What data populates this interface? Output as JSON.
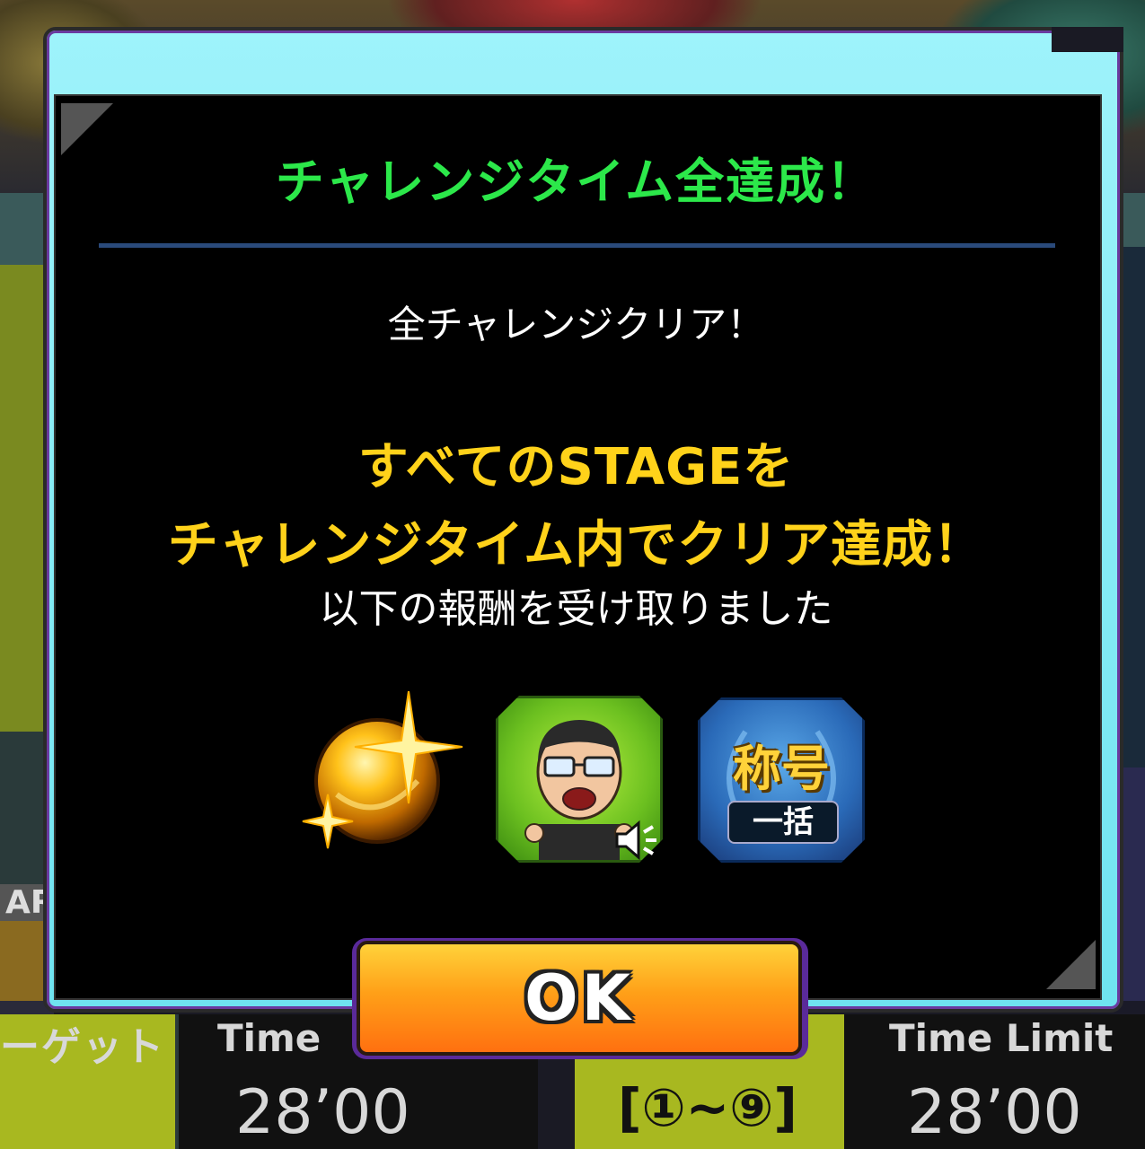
{
  "dialog": {
    "title": "チャレンジタイム全達成！",
    "subtitle": "全チャレンジクリア！",
    "message_line1": "すべてのSTAGEを",
    "message_line2": "チャレンジタイム内でクリア達成！",
    "message_line3": "以下の報酬を受け取りました",
    "ok_label": "OK"
  },
  "rewards": [
    {
      "type": "orb",
      "icon": "gold-orb-icon"
    },
    {
      "type": "character-voice",
      "icon": "character-portrait-icon",
      "extra": "speaker-icon"
    },
    {
      "type": "title",
      "label": "称号",
      "tag": "一括"
    }
  ],
  "background": {
    "left_label": "ーゲット",
    "left_badge": "AR",
    "time_label_1": "Time",
    "time_value_1": "28’00",
    "time_label_2": "Time Limit",
    "time_value_2": "28’00",
    "stage_range": "[①~⑨]"
  },
  "colors": {
    "title_green": "#2ce84a",
    "message_yellow": "#ffd21a",
    "frame_cyan": "#6fe3f0",
    "ok_orange": "#ffa018"
  }
}
